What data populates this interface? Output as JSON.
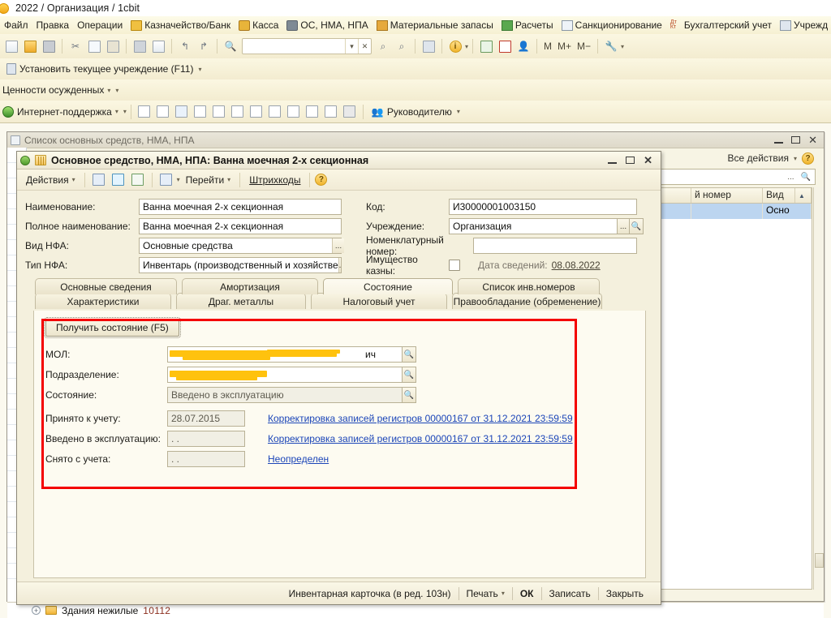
{
  "app": {
    "title": "2022 / Организация / 1cbit",
    "icon": "app-logo-icon"
  },
  "menubar": [
    {
      "label": "Файл",
      "icon": null
    },
    {
      "label": "Правка",
      "icon": null
    },
    {
      "label": "Операции",
      "icon": null
    },
    {
      "label": "Казначейство/Банк",
      "icon": "bank-icon"
    },
    {
      "label": "Касса",
      "icon": "cash-icon"
    },
    {
      "label": "ОС, НМА, НПА",
      "icon": "fixed-assets-icon"
    },
    {
      "label": "Материальные запасы",
      "icon": "materials-icon"
    },
    {
      "label": "Расчеты",
      "icon": "settlements-icon"
    },
    {
      "label": "Санкционирование",
      "icon": "sanction-icon"
    },
    {
      "label": "Бухгалтерский учет",
      "icon": "accounting-icon"
    },
    {
      "label": "Учрежд",
      "icon": "institution-icon"
    }
  ],
  "toolbar_main": {
    "icons": [
      "new-document-icon",
      "open-folder-icon",
      "save-icon",
      "cut-icon",
      "copy-icon",
      "paste-icon",
      "print-icon",
      "print-preview-icon",
      "undo-icon",
      "redo-icon",
      "find-icon"
    ],
    "search_value": "",
    "search_dropdown_icon": "chevron-down-icon",
    "search_clear_icon": "close-icon",
    "icons2": [
      "search-next-icon",
      "search-prev-icon",
      "windows-icon",
      "info-icon",
      "calculator-icon",
      "calendar-icon",
      "user-account-icon"
    ],
    "memory_buttons": [
      "M",
      "M+",
      "M−"
    ],
    "settings_icon": "wrench-icon"
  },
  "toolbar_institution": {
    "icon": "clipboard-icon",
    "label": "Установить текущее учреждение (F11)"
  },
  "toolbar_values": {
    "label": "Ценности осужденных"
  },
  "toolbar_support": {
    "icon": "globe-icon",
    "label": "Интернет-поддержка",
    "report_icons": [
      "report-sum-icon",
      "report-t-icon",
      "report-add-icon",
      "report-person-t-icon",
      "report-person-list-icon",
      "report-doc-t-icon",
      "report-doc-list-icon",
      "report-add-t-icon",
      "report-add-list-icon",
      "report-k-sum-icon",
      "report-k-icon",
      "report-grid-icon"
    ],
    "chief_icon": "chief-icon",
    "chief_label": "Руководителю"
  },
  "list_window": {
    "icon": "window-icon",
    "title": "Список основных средств, НМА, НПА",
    "all_actions": "Все действия",
    "help_icon": "help-icon",
    "minimize_icon": "minimize-icon",
    "maximize_icon": "maximize-icon",
    "close_icon": "close-icon",
    "search_value": "",
    "search_dots": "...",
    "search_icon": "search-icon",
    "columns": [
      "й номер",
      "Вид "
    ],
    "sort_icon": "sort-asc-icon",
    "rows": [
      {
        "number": "",
        "kind": "Осно"
      }
    ]
  },
  "bottom_tree": {
    "expand_icon": "expand-plus-icon",
    "folder_icon": "folder-icon",
    "label": "Здания нежилые",
    "code": "10112"
  },
  "dialog": {
    "title": "Основное средство, НМА, НПА: Ванна моечная 2-х секционная",
    "app_icon": "app-status-icon",
    "doc_icon": "fixed-asset-icon",
    "minimize_icon": "minimize-icon",
    "maximize_icon": "maximize-icon",
    "close_icon": "close-icon",
    "toolbar": {
      "actions_label": "Действия",
      "actions_caret": "▾",
      "icon_back": "go-back-icon",
      "icon_refresh": "refresh-icon",
      "icon_copy": "copy-record-icon",
      "icon_goto": "go-to-icon",
      "goto_label": "Перейти",
      "barcode_label": "Штрихкоды",
      "help_icon": "help-icon"
    },
    "fields": {
      "name_label": "Наименование:",
      "name_value": "Ванна моечная 2-х секционная",
      "full_name_label": "Полное наименование:",
      "full_name_value": "Ванна моечная 2-х секционная",
      "nfa_kind_label": "Вид НФА:",
      "nfa_kind_value": "Основные средства",
      "nfa_type_label": "Тип НФА:",
      "nfa_type_value": "Инвентарь (производственный и хозяйстве",
      "code_label": "Код:",
      "code_value": "И30000001003150",
      "institution_label": "Учреждение:",
      "institution_value": "Организация",
      "nomenclature_label": "Номенклатурный номер:",
      "nomenclature_value": "",
      "treasury_label": "Имущество казны:",
      "treasury_checked": false,
      "info_date_label": "Дата сведений:",
      "info_date_value": "08.08.2022",
      "dots_button": "...",
      "search_button": "search-icon"
    },
    "tabs_row1": [
      {
        "label": "Основные сведения",
        "selected": false
      },
      {
        "label": "Амортизация",
        "selected": false
      },
      {
        "label": "Состояние",
        "selected": true
      },
      {
        "label": "Список инв.номеров",
        "selected": false
      }
    ],
    "tabs_row2": [
      {
        "label": "Характеристики",
        "selected": false
      },
      {
        "label": "Драг. металлы",
        "selected": false
      },
      {
        "label": "Налоговый учет",
        "selected": false
      },
      {
        "label": "Правообладание (обременение)",
        "selected": false
      }
    ],
    "state_tab": {
      "get_state_button": "Получить состояние (F5)",
      "mol_label": "МОЛ:",
      "mol_value": "",
      "mol_redacted": true,
      "division_label": "Подразделение:",
      "division_value": "",
      "division_redacted": true,
      "state_label": "Состояние:",
      "state_value": "Введено в эксплуатацию",
      "accepted_label": "Принято к учету:",
      "accepted_value": "28.07.2015",
      "accepted_link": "Корректировка записей регистров 00000167 от 31.12.2021 23:59:59",
      "commissioned_label": "Введено в эксплуатацию:",
      "commissioned_value": ". .",
      "commissioned_link": "Корректировка записей регистров 00000167 от 31.12.2021 23:59:59",
      "removed_label": "Снято с учета:",
      "removed_value": ". .",
      "removed_link": "Неопределен",
      "select_icon": "search-icon"
    },
    "footer": {
      "inventory_card": "Инвентарная карточка (в ред. 103н)",
      "print": "Печать",
      "print_caret": "▾",
      "ok": "ОК",
      "write": "Записать",
      "close": "Закрыть"
    }
  },
  "colors": {
    "accent": "#f0b42c",
    "highlight_box": "#f40000",
    "link": "#1b45b8",
    "redaction": "#ffc20e",
    "selection": "#bcd5f0"
  }
}
